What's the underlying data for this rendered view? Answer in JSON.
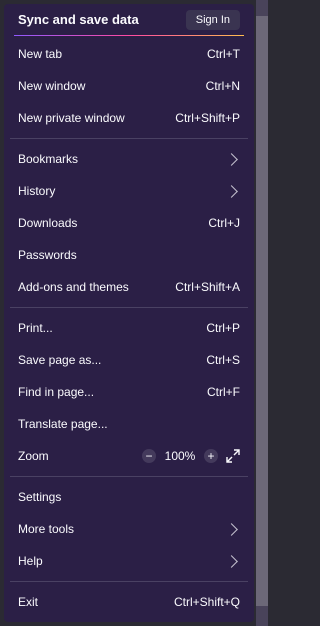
{
  "sync": {
    "title": "Sync and save data",
    "sign_in_label": "Sign In"
  },
  "group1": [
    {
      "label": "New tab",
      "shortcut": "Ctrl+T"
    },
    {
      "label": "New window",
      "shortcut": "Ctrl+N"
    },
    {
      "label": "New private window",
      "shortcut": "Ctrl+Shift+P"
    }
  ],
  "group2": [
    {
      "label": "Bookmarks",
      "icon": "chevron-right-icon"
    },
    {
      "label": "History",
      "icon": "chevron-right-icon"
    },
    {
      "label": "Downloads",
      "shortcut": "Ctrl+J"
    },
    {
      "label": "Passwords"
    },
    {
      "label": "Add-ons and themes",
      "shortcut": "Ctrl+Shift+A"
    }
  ],
  "group3": [
    {
      "label": "Print...",
      "shortcut": "Ctrl+P"
    },
    {
      "label": "Save page as...",
      "shortcut": "Ctrl+S"
    },
    {
      "label": "Find in page...",
      "shortcut": "Ctrl+F"
    },
    {
      "label": "Translate page..."
    }
  ],
  "zoom": {
    "label": "Zoom",
    "value": "100%",
    "minus": "−",
    "plus": "+"
  },
  "group4": [
    {
      "label": "Settings"
    },
    {
      "label": "More tools",
      "icon": "chevron-right-icon"
    },
    {
      "label": "Help",
      "icon": "chevron-right-icon"
    }
  ],
  "exit": {
    "label": "Exit",
    "shortcut": "Ctrl+Shift+Q"
  },
  "colors": {
    "menu_bg": "#2b1f46",
    "text": "#fbfbfe",
    "separator": "#4a4163",
    "accent_gradient_start": "#9059ff",
    "accent_gradient_end": "#ffbd4f"
  }
}
